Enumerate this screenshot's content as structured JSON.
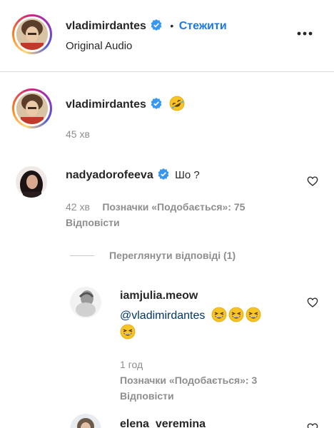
{
  "post": {
    "username": "vladimirdantes",
    "follow_label": "Стежити",
    "separator": "•",
    "audio": "Original Audio",
    "more_label": "•••"
  },
  "caption": {
    "username": "vladimirdantes",
    "time": "45 хв"
  },
  "comments": [
    {
      "username": "nadyadorofeeva",
      "text": "Шо ?",
      "time": "42 хв",
      "likes": "Позначки «Подобається»: 75",
      "reply": "Відповісти"
    }
  ],
  "view_replies": "Переглянути відповіді (1)",
  "replies": [
    {
      "username": "iamjulia.meow",
      "mention": "@vladimirdantes",
      "time": "1 год",
      "likes": "Позначки «Подобається»: 3",
      "reply": "Відповісти"
    }
  ],
  "next_comment": {
    "username": "elena_veremina"
  },
  "colors": {
    "link": "#1a77f2",
    "verified": "#3897f0",
    "muted": "#8e8e8e",
    "text": "#262626"
  }
}
